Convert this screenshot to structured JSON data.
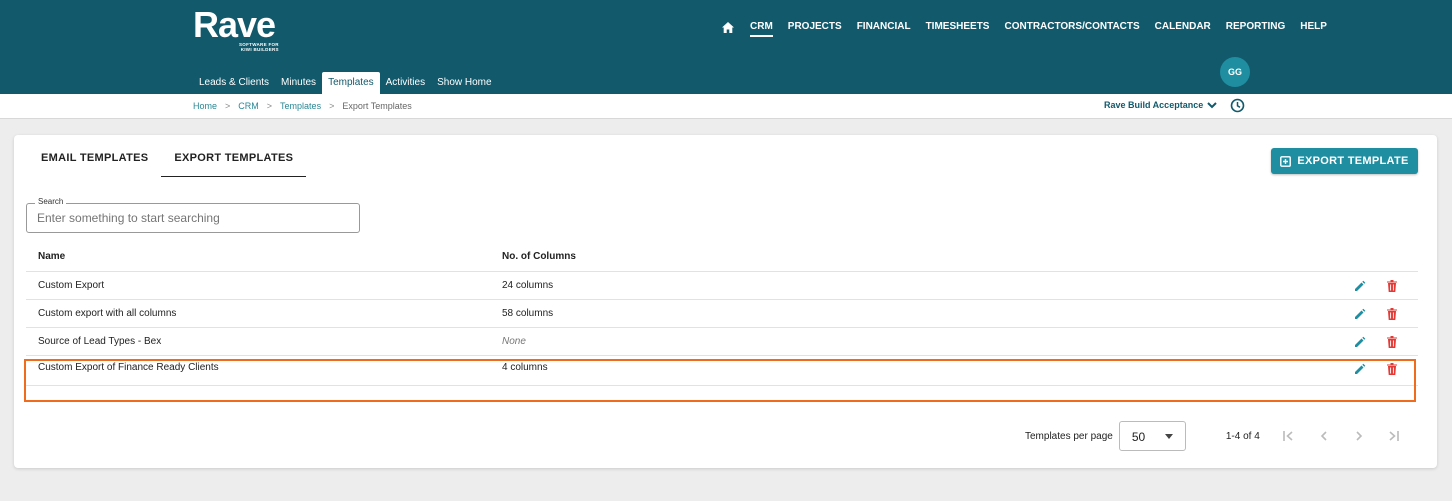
{
  "app": {
    "logo_text": "Rave",
    "logo_tagline_1": "SOFTWARE FOR",
    "logo_tagline_2": "KIWI BUILDERS"
  },
  "main_nav": {
    "home_icon": "home-icon",
    "items": [
      {
        "label": "CRM",
        "active": true
      },
      {
        "label": "PROJECTS"
      },
      {
        "label": "FINANCIAL"
      },
      {
        "label": "TIMESHEETS"
      },
      {
        "label": "CONTRACTORS/CONTACTS"
      },
      {
        "label": "CALENDAR"
      },
      {
        "label": "REPORTING"
      },
      {
        "label": "HELP"
      }
    ]
  },
  "sub_nav": {
    "items": [
      {
        "label": "Leads & Clients"
      },
      {
        "label": "Minutes"
      },
      {
        "label": "Templates",
        "active": true
      },
      {
        "label": "Activities"
      },
      {
        "label": "Show Home"
      }
    ]
  },
  "user": {
    "initials": "GG"
  },
  "breadcrumb": {
    "items": [
      "Home",
      "CRM",
      "Templates"
    ],
    "current": "Export Templates",
    "separator": ">"
  },
  "org_selector": {
    "label": "Rave Build Acceptance"
  },
  "tabs": [
    {
      "label": "EMAIL TEMPLATES"
    },
    {
      "label": "EXPORT TEMPLATES",
      "active": true
    }
  ],
  "actions": {
    "export_template_label": "EXPORT TEMPLATE"
  },
  "search": {
    "label": "Search",
    "placeholder": "Enter something to start searching",
    "value": ""
  },
  "table": {
    "headers": {
      "name": "Name",
      "columns": "No. of Columns"
    },
    "rows": [
      {
        "name": "Custom Export",
        "columns": "24 columns"
      },
      {
        "name": "Custom export with all columns",
        "columns": "58 columns"
      },
      {
        "name": "Source of Lead Types - Bex",
        "columns": "None"
      },
      {
        "name": "Custom Export of Finance Ready Clients",
        "columns": "4 columns"
      }
    ]
  },
  "pagination": {
    "per_page_label": "Templates per page",
    "per_page_value": "50",
    "range": "1-4 of 4"
  },
  "colors": {
    "header_bg": "#12596b",
    "accent": "#1f8ea0",
    "delete": "#e53935",
    "highlight": "#ef6c1f"
  }
}
